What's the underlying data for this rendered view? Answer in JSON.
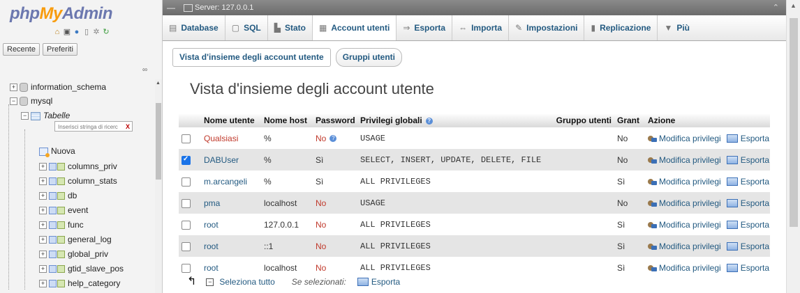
{
  "nav": {
    "logo_php": "php",
    "logo_my": "My",
    "logo_admin": "Admin",
    "tab_recent": "Recente",
    "tab_favorites": "Preferiti",
    "filter_placeholder": "Inserisci stringa di ricerc",
    "filter_clear": "X",
    "tree": {
      "db_information_schema": "information_schema",
      "db_mysql": "mysql",
      "tables_folder": "Tabelle",
      "new_table": "Nuova",
      "tables": [
        "columns_priv",
        "column_stats",
        "db",
        "event",
        "func",
        "general_log",
        "global_priv",
        "gtid_slave_pos",
        "help_category"
      ]
    }
  },
  "topbar": {
    "server_label": "Server: 127.0.0.1"
  },
  "tabs": [
    {
      "label": "Database",
      "icon": "database-icon"
    },
    {
      "label": "SQL",
      "icon": "sql-icon"
    },
    {
      "label": "Stato",
      "icon": "status-icon"
    },
    {
      "label": "Account utenti",
      "icon": "users-icon"
    },
    {
      "label": "Esporta",
      "icon": "export-icon"
    },
    {
      "label": "Importa",
      "icon": "import-icon"
    },
    {
      "label": "Impostazioni",
      "icon": "settings-icon"
    },
    {
      "label": "Replicazione",
      "icon": "replication-icon"
    },
    {
      "label": "Più",
      "icon": "more-icon"
    }
  ],
  "subtabs": {
    "overview": "Vista d'insieme degli account utente",
    "groups": "Gruppi utenti"
  },
  "page_title": "Vista d'insieme degli account utente",
  "table": {
    "headers": {
      "user": "Nome utente",
      "host": "Nome host",
      "password": "Password",
      "privileges": "Privilegi globali",
      "group": "Gruppo utenti",
      "grant": "Grant",
      "action": "Azione"
    },
    "edit_label": "Modifica privilegi",
    "export_label": "Esporta",
    "rows": [
      {
        "user": "Qualsiasi",
        "host": "%",
        "password": "No",
        "privileges": "USAGE",
        "grant": "No",
        "checked": false
      },
      {
        "user": "DABUser",
        "host": "%",
        "password": "Sì",
        "privileges": "SELECT, INSERT, UPDATE, DELETE, FILE",
        "grant": "No",
        "checked": true
      },
      {
        "user": "m.arcangeli",
        "host": "%",
        "password": "Sì",
        "privileges": "ALL PRIVILEGES",
        "grant": "Sì",
        "checked": false
      },
      {
        "user": "pma",
        "host": "localhost",
        "password": "No",
        "privileges": "USAGE",
        "grant": "No",
        "checked": false
      },
      {
        "user": "root",
        "host": "127.0.0.1",
        "password": "No",
        "privileges": "ALL PRIVILEGES",
        "grant": "Sì",
        "checked": false
      },
      {
        "user": "root",
        "host": "::1",
        "password": "No",
        "privileges": "ALL PRIVILEGES",
        "grant": "Sì",
        "checked": false
      },
      {
        "user": "root",
        "host": "localhost",
        "password": "No",
        "privileges": "ALL PRIVILEGES",
        "grant": "Sì",
        "checked": false
      }
    ]
  },
  "bulk": {
    "select_all": "Seleziona tutto",
    "if_selected": "Se selezionati:",
    "export": "Esporta"
  },
  "colors": {
    "link": "#235a81",
    "no_password": "#c0392b",
    "logo_blue": "#6c78af",
    "logo_orange": "#f89c0e"
  }
}
